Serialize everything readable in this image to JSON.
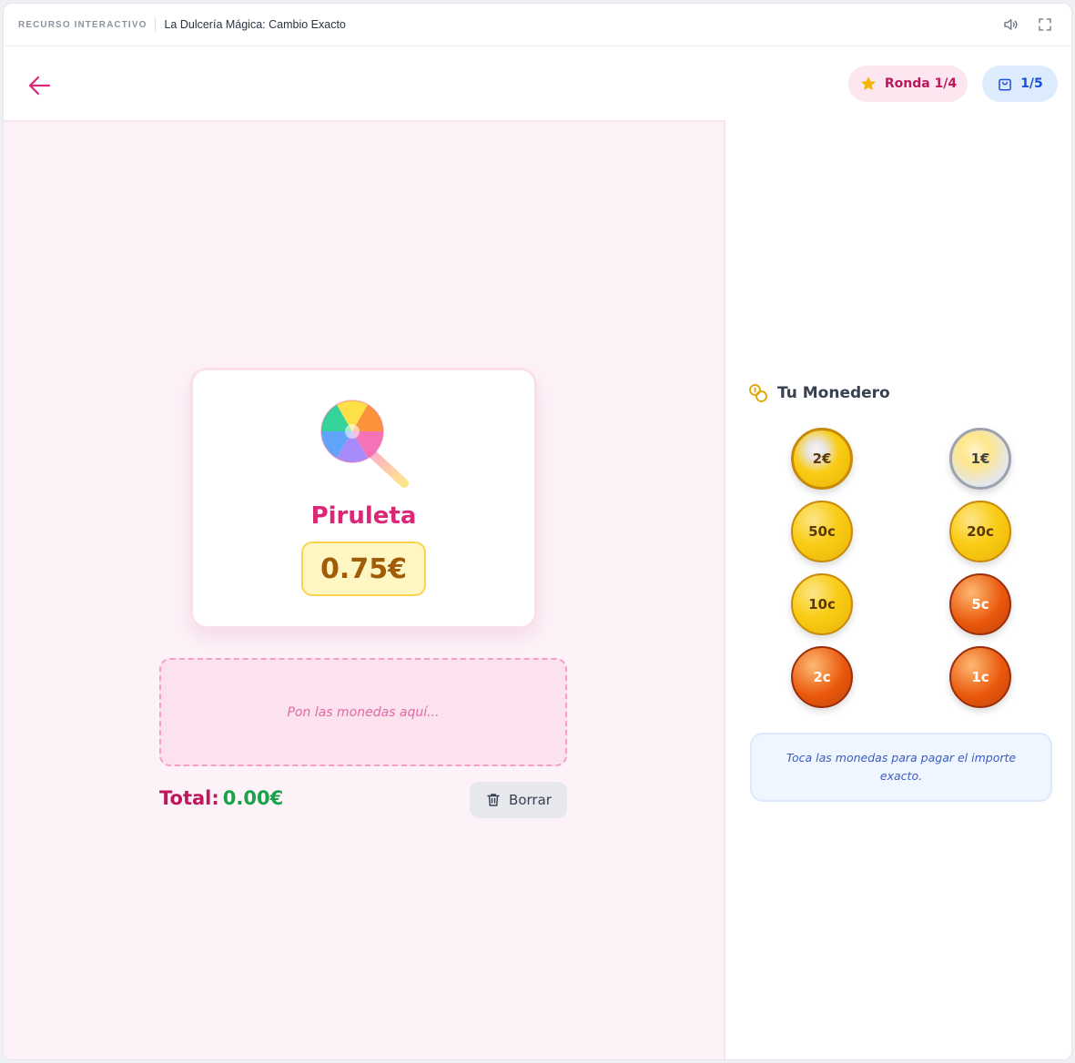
{
  "resource_bar": {
    "tag": "RECURSO INTERACTIVO",
    "title": "La Dulcería Mágica: Cambio Exacto",
    "icons": [
      "speaker-icon",
      "fullscreen-icon"
    ]
  },
  "header": {
    "back_icon": "arrow-left-icon",
    "round_label": "Ronda 1/4",
    "round_icon": "star-icon",
    "basket_label": "1/5",
    "basket_icon": "shopping-bag-icon"
  },
  "product": {
    "name": "Piruleta",
    "price": "0.75€",
    "icon": "lollipop-icon"
  },
  "drop_zone": {
    "hint": "Pon las monedas aquí..."
  },
  "total": {
    "label": "Total:",
    "value": "0.00€"
  },
  "clear_button": {
    "label": "Borrar",
    "icon": "trash-icon"
  },
  "wallet": {
    "title": "Tu Monedero",
    "title_icon": "coins-icon",
    "coins": [
      {
        "label": "2€",
        "style": "bimetal-gold"
      },
      {
        "label": "1€",
        "style": "bimetal-silver"
      },
      {
        "label": "50c",
        "style": "gold"
      },
      {
        "label": "20c",
        "style": "gold"
      },
      {
        "label": "10c",
        "style": "gold"
      },
      {
        "label": "5c",
        "style": "copper"
      },
      {
        "label": "2c",
        "style": "copper"
      },
      {
        "label": "1c",
        "style": "copper"
      }
    ],
    "hint": "Toca las monedas para pagar el importe exacto."
  },
  "colors": {
    "accent_pink": "#db2777",
    "shop_background": "#fdf2f8",
    "price_text": "#a15c07",
    "total_value": "#16a34a",
    "info_blue": "#3b5bbd"
  }
}
